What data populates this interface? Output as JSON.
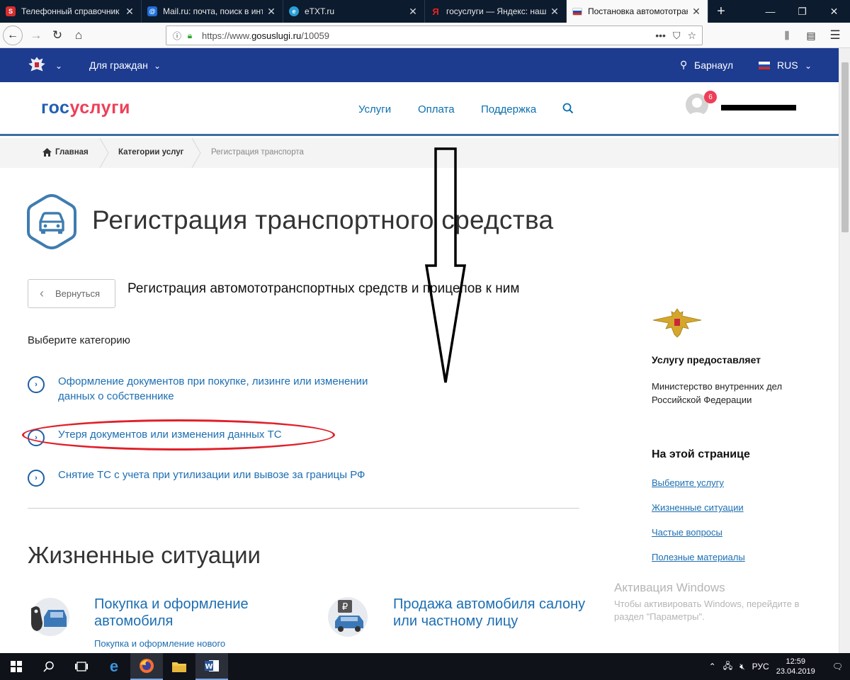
{
  "browser": {
    "tabs": [
      {
        "title": "Телефонный справочник",
        "favicon_color": "#d62e2e",
        "favicon_glyph": "S",
        "active": false
      },
      {
        "title": "Mail.ru: почта, поиск в инте",
        "favicon_color": "#1e6fd9",
        "favicon_glyph": "@",
        "active": false
      },
      {
        "title": "eTXT.ru",
        "favicon_color": "#2a9fd6",
        "favicon_glyph": "e",
        "active": false
      },
      {
        "title": "госуслуги — Яндекс: нашл",
        "favicon_color": "#e8231e",
        "favicon_glyph": "Я",
        "active": false
      },
      {
        "title": "Постановка автомототранс",
        "favicon_color": "#d0d8e8",
        "favicon_glyph": "",
        "active": true
      }
    ],
    "new_tab": "+",
    "url_prefix": "https://www.",
    "url_domain": "gosuslugi.ru",
    "url_path": "/10059",
    "url_menu": "•••"
  },
  "gov_top": {
    "citizens": "Для граждан",
    "city": "Барнаул",
    "lang": "RUS"
  },
  "header": {
    "logo_part1": "гос",
    "logo_part2": "услуги",
    "nav": [
      "Услуги",
      "Оплата",
      "Поддержка"
    ],
    "notifications": "6"
  },
  "breadcrumbs": {
    "home": "Главная",
    "category": "Категории услуг",
    "current": "Регистрация транспорта"
  },
  "page": {
    "title": "Регистрация транспортного средства",
    "back": "Вернуться",
    "subtitle": "Регистрация автомототранспортных средств и прицепов к ним",
    "choose": "Выберите категорию",
    "options": [
      "Оформление документов при покупке, лизинге или изменении данных о собственнике",
      "Утеря документов или изменения данных ТС",
      "Снятие ТС с учета при утилизации или вывозе за границы РФ"
    ],
    "life_title": "Жизненные ситуации",
    "cards": [
      {
        "title": "Покупка и оформление автомобиля",
        "sub": "Покупка и оформление нового"
      },
      {
        "title": "Продажа автомобиля салону или частному лицу",
        "sub": ""
      }
    ]
  },
  "sidebar": {
    "provider_heading": "Услугу предоставляет",
    "provider": "Министерство внутренних дел Российской Федерации",
    "onpage_heading": "На этой странице",
    "links": [
      "Выберите услугу",
      "Жизненные ситуации",
      "Частые вопросы",
      "Полезные материалы"
    ]
  },
  "watermark": {
    "title": "Активация Windows",
    "text": "Чтобы активировать Windows, перейдите в раздел \"Параметры\"."
  },
  "taskbar": {
    "lang": "РУС",
    "time": "12:59",
    "date": "23.04.2019"
  },
  "colors": {
    "gov_blue": "#1d3b8f",
    "link_blue": "#1c6eb2",
    "logo_red": "#ee3f58",
    "highlight_red": "#e0202a"
  }
}
